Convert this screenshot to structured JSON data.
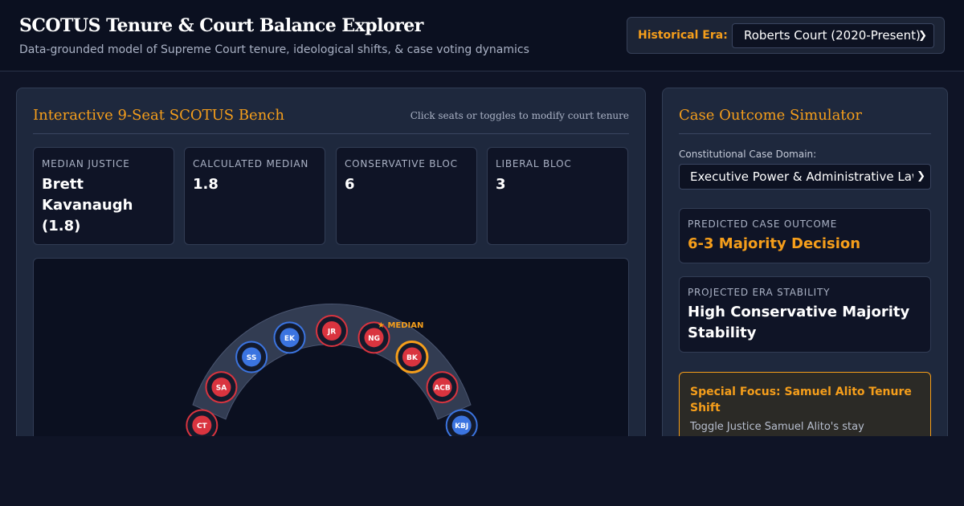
{
  "app": {
    "title": "SCOTUS Tenure & Court Balance Explorer",
    "subtitle": "Data-grounded model of Supreme Court tenure, ideological shifts, & case voting dynamics"
  },
  "era_selector": {
    "label": "Historical Era:",
    "selected": "Roberts Court (2020-Present)"
  },
  "bench_panel": {
    "title": "Interactive 9-Seat SCOTUS Bench",
    "hint": "Click seats or toggles to modify court tenure",
    "stats": [
      {
        "label": "Median Justice",
        "value": "Brett Kavanaugh (1.8)"
      },
      {
        "label": "Calculated Median",
        "value": "1.8"
      },
      {
        "label": "Conservative Bloc",
        "value": "6"
      },
      {
        "label": "Liberal Bloc",
        "value": "3"
      }
    ],
    "median_marker": "★ MEDIAN",
    "seats": [
      {
        "initials": "CT",
        "bloc": "conservative"
      },
      {
        "initials": "SA",
        "bloc": "conservative"
      },
      {
        "initials": "SS",
        "bloc": "liberal"
      },
      {
        "initials": "EK",
        "bloc": "liberal"
      },
      {
        "initials": "JR",
        "bloc": "conservative"
      },
      {
        "initials": "NG",
        "bloc": "conservative"
      },
      {
        "initials": "BK",
        "bloc": "conservative",
        "median": true
      },
      {
        "initials": "ACB",
        "bloc": "conservative"
      },
      {
        "initials": "KBJ",
        "bloc": "liberal"
      }
    ]
  },
  "simulator_panel": {
    "title": "Case Outcome Simulator",
    "domain_label": "Constitutional Case Domain:",
    "domain_selected": "Executive Power & Administrative Law",
    "predicted_label": "Predicted Case Outcome",
    "predicted_value": "6-3 Majority Decision",
    "stability_label": "Projected Era Stability",
    "stability_value": "High Conservative Majority Stability",
    "focus_title": "Special Focus: Samuel Alito Tenure Shift",
    "focus_desc": "Toggle Justice Samuel Alito's stay"
  },
  "colors": {
    "accent": "#f59e1b",
    "conservative": "#d9343f",
    "liberal": "#3b74e0",
    "median_ring": "#f59e1b"
  }
}
